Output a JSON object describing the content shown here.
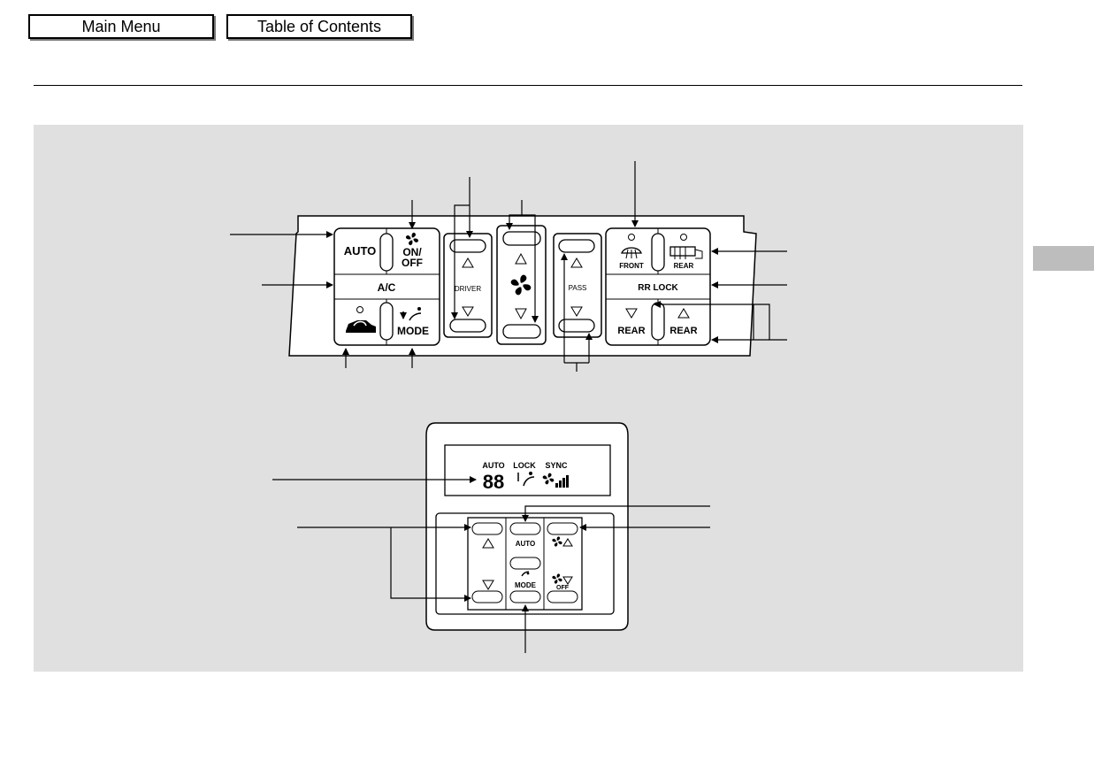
{
  "nav": {
    "main_menu": "Main Menu",
    "table_of_contents": "Table of Contents"
  },
  "front_panel": {
    "auto": "AUTO",
    "on": "ON/",
    "off": "OFF",
    "ac": "A/C",
    "mode": "MODE",
    "driver": "DRIVER",
    "pass": "PASS",
    "front": "FRONT",
    "rear": "REAR",
    "rr_lock": "RR LOCK",
    "rear_down": "REAR",
    "rear_up": "REAR"
  },
  "rear_panel": {
    "disp_auto": "AUTO",
    "disp_lock": "LOCK",
    "disp_sync": "SYNC",
    "disp_temp": "88",
    "btn_auto": "AUTO",
    "btn_mode": "MODE",
    "fan_off": "OFF"
  },
  "icons": [
    "fan-icon",
    "up-arrow-icon",
    "down-arrow-icon",
    "front-defrost-icon",
    "rear-defrost-icon",
    "recirculation-car-icon",
    "mode-airflow-icon"
  ]
}
